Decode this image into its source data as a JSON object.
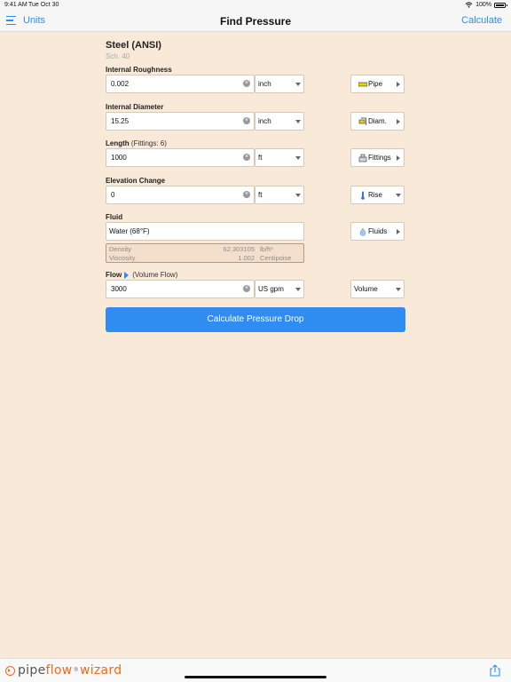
{
  "status": {
    "time": "9:41 AM",
    "date": "Tue Oct 30",
    "battery": "100%"
  },
  "nav": {
    "units": "Units",
    "title": "Find Pressure",
    "calculate": "Calculate"
  },
  "pipe": {
    "name": "Steel (ANSI)",
    "schedule": "Sch.  40"
  },
  "roughness": {
    "label": "Internal Roughness",
    "value": "0.002",
    "unit": "inch",
    "button": "Pipe"
  },
  "diameter": {
    "label": "Internal Diameter",
    "value": "15.25",
    "unit": "inch",
    "button": "Diam."
  },
  "length": {
    "label": "Length",
    "sub": "(Fittings: 6)",
    "value": "1000",
    "unit": "ft",
    "button": "Fittings"
  },
  "elevation": {
    "label": "Elevation Change",
    "value": "0",
    "unit": "ft",
    "button": "Rise"
  },
  "fluid": {
    "label": "Fluid",
    "value": "Water (68°F)",
    "button": "Fluids",
    "density_label": "Density",
    "density_value": "62.303105",
    "density_unit": "lb/ft³",
    "viscosity_label": "Viscosity",
    "viscosity_value": "1.002",
    "viscosity_unit": "Centipoise"
  },
  "flow": {
    "label": "Flow",
    "sub": "(Volume Flow)",
    "value": "3000",
    "unit": "US gpm",
    "type": "Volume"
  },
  "action": {
    "label": "Calculate Pressure Drop"
  },
  "footer": {
    "logo_pipe": "pipe",
    "logo_flow": "flow",
    "logo_reg": "®",
    "logo_wizard": "wizard"
  },
  "colors": {
    "accent": "#2f8cf0",
    "background": "#f9e9d8",
    "brand_orange": "#ee6a1e"
  }
}
